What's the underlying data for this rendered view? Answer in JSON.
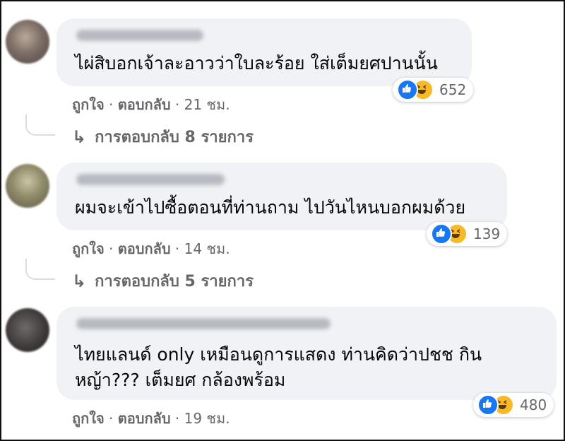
{
  "comments": [
    {
      "text": "ไผ่สิบอกเจ้าละอาวว่าใบละร้อย ใส่เต็มยศปานนั้น",
      "reaction_count": "652",
      "like_label": "ถูกใจ",
      "reply_label": "ตอบกลับ",
      "timestamp": "21 ชม.",
      "replies_label": "การตอบกลับ 8 รายการ"
    },
    {
      "text": "ผมจะเข้าไปซื้อตอนที่ท่านถาม ไปวันไหนบอกผมด้วย",
      "reaction_count": "139",
      "like_label": "ถูกใจ",
      "reply_label": "ตอบกลับ",
      "timestamp": "14 ชม.",
      "replies_label": "การตอบกลับ 5 รายการ"
    },
    {
      "text_line1": "ไทยแลนด์ only เหมือนดูการแสดง ท่านคิดว่าปชช กิน",
      "text_line2": "หญ้า??? เต็มยศ กล้องพร้อม",
      "reaction_count": "480",
      "like_label": "ถูกใจ",
      "reply_label": "ตอบกลับ",
      "timestamp": "19 ชม."
    }
  ],
  "separator": " · ",
  "reply_arrow": "↳",
  "icons": {
    "like": "like-icon",
    "haha": "haha-icon"
  },
  "colors": {
    "bubble": "#f0f2f5",
    "like_blue": "#1877f2",
    "haha_yellow": "#f7b928",
    "meta_text": "#65676b"
  }
}
